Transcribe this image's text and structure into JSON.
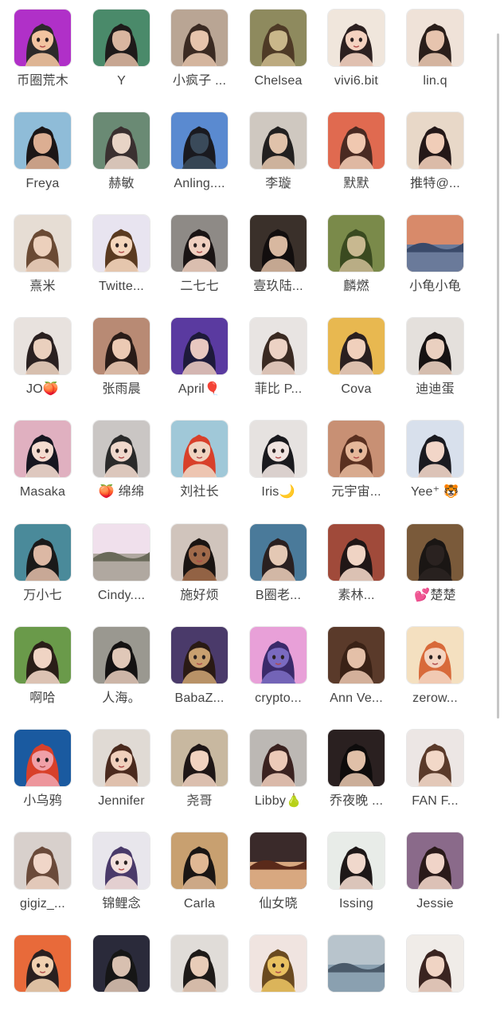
{
  "contacts": [
    {
      "name": "币圈荒木",
      "bg": "#b030c8",
      "fg": "#f2c4a0",
      "hair": "#2c2a2a",
      "kind": "cartoon"
    },
    {
      "name": "Y",
      "bg": "#4a8a6a",
      "fg": "#d9b6a0",
      "hair": "#1e1a1a",
      "kind": "photo"
    },
    {
      "name": "小疯子 ...",
      "bg": "#b9a594",
      "fg": "#e6c4ac",
      "hair": "#3a2a22",
      "kind": "photo"
    },
    {
      "name": "Chelsea",
      "bg": "#8e8a5e",
      "fg": "#c9b78a",
      "hair": "#4e3a26",
      "kind": "photo"
    },
    {
      "name": "vivi6.bit",
      "bg": "#f0e6dc",
      "fg": "#f4d2c0",
      "hair": "#2c2020",
      "kind": "cartoon"
    },
    {
      "name": "lin.q",
      "bg": "#efe2d8",
      "fg": "#e7c4ae",
      "hair": "#2a1e1a",
      "kind": "photo"
    },
    {
      "name": "Freya",
      "bg": "#8fbcd8",
      "fg": "#dcae92",
      "hair": "#1c1616",
      "kind": "photo"
    },
    {
      "name": "赫敏",
      "bg": "#6a8a74",
      "fg": "#e8d4c6",
      "hair": "#3a3030",
      "kind": "photo"
    },
    {
      "name": "Anling....",
      "bg": "#5a8ad0",
      "fg": "#3a4a5a",
      "hair": "#1a1a20",
      "kind": "photo"
    },
    {
      "name": "李璇",
      "bg": "#cfc8c0",
      "fg": "#e0c2aa",
      "hair": "#222020",
      "kind": "photo"
    },
    {
      "name": "默默",
      "bg": "#e06a50",
      "fg": "#f0c8b0",
      "hair": "#4a2a22",
      "kind": "photo"
    },
    {
      "name": "推特@...",
      "bg": "#e8d8c8",
      "fg": "#f0cdb8",
      "hair": "#241818",
      "kind": "photo"
    },
    {
      "name": "熹米",
      "bg": "#e6ddd4",
      "fg": "#ecd0bc",
      "hair": "#6a4a34",
      "kind": "photo"
    },
    {
      "name": "Twitte...",
      "bg": "#e8e4f0",
      "fg": "#f4d6bc",
      "hair": "#5a3a20",
      "kind": "cartoon"
    },
    {
      "name": "二七七",
      "bg": "#8e8a86",
      "fg": "#f0d0c0",
      "hair": "#1a1414",
      "kind": "cartoon"
    },
    {
      "name": "壹玖陆...",
      "bg": "#3a302a",
      "fg": "#d8b8a0",
      "hair": "#120e0e",
      "kind": "photo"
    },
    {
      "name": "麟燃",
      "bg": "#7a8a4a",
      "fg": "#c8b890",
      "hair": "#3a4a20",
      "kind": "photo"
    },
    {
      "name": "小龟小龟",
      "bg": "#d88a6a",
      "fg": "#6a7a9a",
      "hair": "#3a4a6a",
      "kind": "scene"
    },
    {
      "name": "JO🍑",
      "bg": "#e8e2de",
      "fg": "#ead0be",
      "hair": "#2a2020",
      "kind": "photo"
    },
    {
      "name": "张雨晨",
      "bg": "#b88a74",
      "fg": "#eccab4",
      "hair": "#2a1c18",
      "kind": "photo"
    },
    {
      "name": "April🎈",
      "bg": "#5a3aa0",
      "fg": "#e8c8c0",
      "hair": "#1e1a3a",
      "kind": "photo"
    },
    {
      "name": "菲比 P...",
      "bg": "#e8e4e2",
      "fg": "#ecd2c4",
      "hair": "#3a2a22",
      "kind": "photo"
    },
    {
      "name": "Cova",
      "bg": "#e8b850",
      "fg": "#f0d0bc",
      "hair": "#2a2020",
      "kind": "photo"
    },
    {
      "name": "迪迪蛋",
      "bg": "#e4e0dc",
      "fg": "#ead0c0",
      "hair": "#161212",
      "kind": "photo"
    },
    {
      "name": "Masaka",
      "bg": "#e0b0c0",
      "fg": "#f4dcd0",
      "hair": "#161620",
      "kind": "cartoon"
    },
    {
      "name": "🍑 绵绵",
      "bg": "#cac6c4",
      "fg": "#f0d8cc",
      "hair": "#2a2a2a",
      "kind": "cartoon"
    },
    {
      "name": "刘社长",
      "bg": "#a0c8d8",
      "fg": "#f0d4c0",
      "hair": "#d8402a",
      "kind": "cartoon"
    },
    {
      "name": "Iris🌙",
      "bg": "#e6e2e0",
      "fg": "#f0e4e0",
      "hair": "#1a1a1e",
      "kind": "cartoon"
    },
    {
      "name": "元宇宙...",
      "bg": "#c89074",
      "fg": "#e6b89a",
      "hair": "#5a3020",
      "kind": "cartoon"
    },
    {
      "name": "Yee⁺ 🐯",
      "bg": "#d8e0ec",
      "fg": "#f2d6c8",
      "hair": "#1a1a20",
      "kind": "photo"
    },
    {
      "name": "万小七",
      "bg": "#4a8a9a",
      "fg": "#dcb8a4",
      "hair": "#1a1a1a",
      "kind": "photo"
    },
    {
      "name": "Cindy....",
      "bg": "#f0e0ec",
      "fg": "#b0a8a0",
      "hair": "#6a6a5a",
      "kind": "scene"
    },
    {
      "name": "施好烦",
      "bg": "#d0c4bc",
      "fg": "#a06a4a",
      "hair": "#1a1412",
      "kind": "cartoon"
    },
    {
      "name": "B圈老...",
      "bg": "#4a7a9a",
      "fg": "#e4c8b4",
      "hair": "#2a2020",
      "kind": "photo"
    },
    {
      "name": "素林...",
      "bg": "#a04a3a",
      "fg": "#f0d4c4",
      "hair": "#201616",
      "kind": "photo"
    },
    {
      "name": "💕楚楚",
      "bg": "#7a5a3a",
      "fg": "#2a2220",
      "hair": "#1a1614",
      "kind": "photo"
    },
    {
      "name": "啊哈",
      "bg": "#6a9a4a",
      "fg": "#f0d4c4",
      "hair": "#2a1e18",
      "kind": "photo"
    },
    {
      "name": "人海。",
      "bg": "#9a9890",
      "fg": "#e0c8b8",
      "hair": "#141212",
      "kind": "photo"
    },
    {
      "name": "BabaZ...",
      "bg": "#4a3a6a",
      "fg": "#c8a070",
      "hair": "#2a1a14",
      "kind": "cartoon"
    },
    {
      "name": "crypto...",
      "bg": "#e8a0d8",
      "fg": "#7a6ac0",
      "hair": "#3a2a6a",
      "kind": "cartoon"
    },
    {
      "name": "Ann Ve...",
      "bg": "#5a3a2a",
      "fg": "#e4c0a8",
      "hair": "#3a2216",
      "kind": "photo"
    },
    {
      "name": "zerow...",
      "bg": "#f4e0c0",
      "fg": "#f4d4c0",
      "hair": "#d86a3a",
      "kind": "cartoon"
    },
    {
      "name": "小乌鸦",
      "bg": "#1a5aa0",
      "fg": "#f0a0a8",
      "hair": "#d8402a",
      "kind": "cartoon"
    },
    {
      "name": "Jennifer",
      "bg": "#e0dad4",
      "fg": "#f0d0bc",
      "hair": "#4a2a1e",
      "kind": "cartoon"
    },
    {
      "name": "尧哥",
      "bg": "#c8b8a0",
      "fg": "#f0d2c0",
      "hair": "#1e1616",
      "kind": "photo"
    },
    {
      "name": "Libby🍐",
      "bg": "#bcb8b4",
      "fg": "#eccab8",
      "hair": "#3a2220",
      "kind": "photo"
    },
    {
      "name": "乔夜晚 ...",
      "bg": "#2a2020",
      "fg": "#e0c0a8",
      "hair": "#0e0c0c",
      "kind": "photo"
    },
    {
      "name": "FAN F...",
      "bg": "#ece6e4",
      "fg": "#f2d8c8",
      "hair": "#5a3a2a",
      "kind": "photo"
    },
    {
      "name": "gigiz_...",
      "bg": "#d8d0cc",
      "fg": "#f0d6c8",
      "hair": "#6a4a3a",
      "kind": "photo"
    },
    {
      "name": "锦鲤念",
      "bg": "#e8e6ec",
      "fg": "#f4e0dc",
      "hair": "#4a3a6a",
      "kind": "cartoon"
    },
    {
      "name": "Carla",
      "bg": "#c8a070",
      "fg": "#e0b894",
      "hair": "#1a1614",
      "kind": "photo"
    },
    {
      "name": "仙女晓",
      "bg": "#3a2a2a",
      "fg": "#d8a880",
      "hair": "#5a2a1a",
      "kind": "scene"
    },
    {
      "name": "Issing",
      "bg": "#e8ece8",
      "fg": "#f0d8cc",
      "hair": "#1e1818",
      "kind": "photo"
    },
    {
      "name": "Jessie",
      "bg": "#8a6a8a",
      "fg": "#f0d4c8",
      "hair": "#2a1a1a",
      "kind": "photo"
    },
    {
      "name": "",
      "bg": "#e86a3a",
      "fg": "#f0d0b0",
      "hair": "#2a2020",
      "kind": "cartoon"
    },
    {
      "name": "",
      "bg": "#2a2a3a",
      "fg": "#d8c0b0",
      "hair": "#161616",
      "kind": "photo"
    },
    {
      "name": "",
      "bg": "#e0dcd8",
      "fg": "#e8ccb8",
      "hair": "#1e1a18",
      "kind": "photo"
    },
    {
      "name": "",
      "bg": "#f0e4e0",
      "fg": "#e8c060",
      "hair": "#6a4a20",
      "kind": "cartoon"
    },
    {
      "name": "",
      "bg": "#b8c4cc",
      "fg": "#8aa0b0",
      "hair": "#4a5a6a",
      "kind": "scene"
    },
    {
      "name": "",
      "bg": "#f0ece8",
      "fg": "#f0d4c4",
      "hair": "#3a2420",
      "kind": "photo"
    }
  ]
}
